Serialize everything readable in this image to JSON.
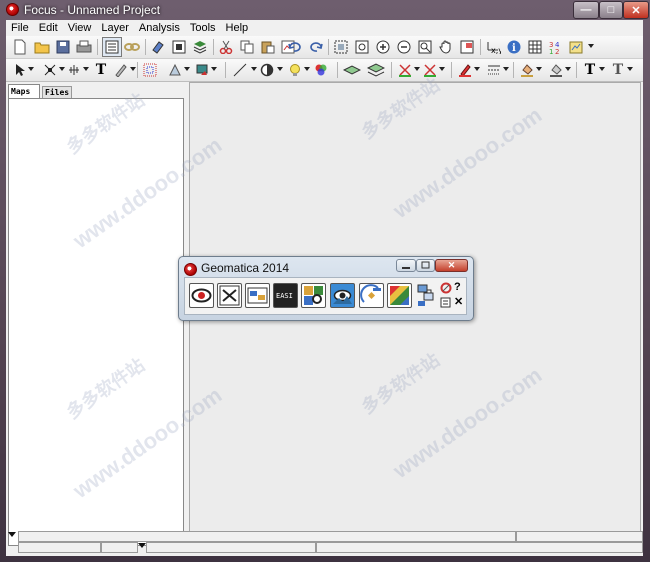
{
  "window": {
    "title": "Focus - Unnamed Project",
    "min": "—",
    "max": "□",
    "close": "✕"
  },
  "menu": [
    "File",
    "Edit",
    "View",
    "Layer",
    "Analysis",
    "Tools",
    "Help"
  ],
  "toolbar1_icons": [
    "new-icon",
    "open-icon",
    "save-icon",
    "print-icon",
    "map-view-icon",
    "link-icon",
    "eraser-icon",
    "area-icon",
    "layers-icon",
    "cut-icon",
    "copy-icon",
    "paste-icon",
    "properties-icon",
    "undo-icon",
    "redo-icon",
    "zoom-extent-icon",
    "zoom-box-icon",
    "zoom-in-icon",
    "zoom-out-icon",
    "zoom-fit-icon",
    "pan-icon",
    "overview-icon",
    "xy-icon",
    "info-icon",
    "table-icon",
    "numbers-icon",
    "report-icon"
  ],
  "toolbar2_icons": [
    "select-icon",
    "node-icon",
    "grid-icon",
    "text-icon",
    "paint-icon",
    "dotted-select-icon",
    "shape-icon",
    "fill-icon",
    "line-icon",
    "ellipse-icon",
    "bulb-icon",
    "colors-icon",
    "layer-stack-icon",
    "layer-stack2-icon",
    "snap-icon",
    "cross-icon",
    "pen-icon",
    "line-style-icon",
    "fill-color-icon",
    "line-color-icon",
    "font-icon",
    "font2-icon"
  ],
  "left_panel": {
    "tabs": [
      "Maps",
      "Files"
    ]
  },
  "geomatica": {
    "title": "Geomatica 2014",
    "buttons": [
      "focus-icon",
      "modeler-icon",
      "ortho-icon",
      "easi-icon",
      "mosaic-icon",
      "view-icon",
      "satellite-icon",
      "chip-icon",
      "algorithm-icon"
    ],
    "side": {
      "help": "?",
      "close": "✕"
    }
  },
  "watermarks": [
    "www.ddooo.com",
    "多多软件站"
  ]
}
